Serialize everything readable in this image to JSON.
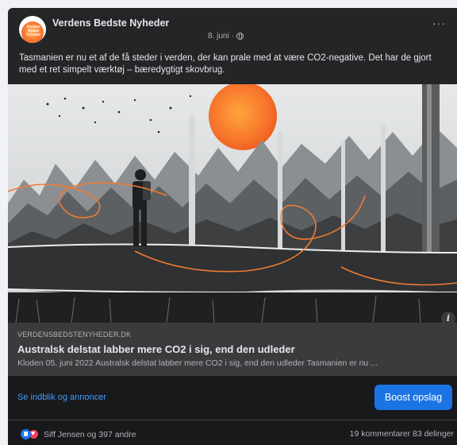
{
  "post": {
    "page_name": "Verdens Bedste Nyheder",
    "avatar_text": "Verdens Bedste Nyheder",
    "date": "8. juni",
    "more_icon": "more-dots-icon",
    "text": "Tasmanien er nu et af de få steder i verden, der kan prale med at være CO2-negative. Det har de gjort med et ret simpelt værktøj – bæredygtigt skovbrug."
  },
  "link": {
    "domain": "VERDENSBEDSTENYHEDER.DK",
    "title": "Australsk delstat labber mere CO2 i sig, end den udleder",
    "description": "Kloden 05. juni 2022 Australsk delstat labber mere CO2 i sig, end den udleder Tasmanien er nu ..."
  },
  "actions": {
    "insights_label": "Se indblik og annoncer",
    "boost_label": "Boost opslag"
  },
  "stats": {
    "reaction_names": "Siff Jensen og 397 andre",
    "comments_shares": "19 kommentarer  83 delinger"
  },
  "colors": {
    "background": "#242526",
    "accent": "#1b74e4",
    "link": "#4599ff",
    "sun": "#f7742c"
  }
}
